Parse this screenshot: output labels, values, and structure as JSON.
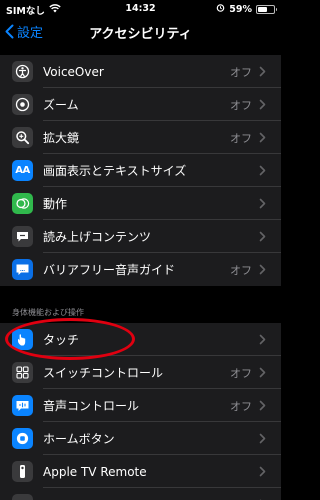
{
  "status": {
    "carrier": "SIMなし",
    "time": "14:32",
    "battery": "59%",
    "battery_level": 0.59
  },
  "nav": {
    "back_label": "設定",
    "title": "アクセシビリティ"
  },
  "vision": [
    {
      "key": "voiceover",
      "label": "VoiceOver",
      "value": "オフ",
      "icon_color": "#3a3a3c",
      "icon": "voiceover-icon"
    },
    {
      "key": "zoom",
      "label": "ズーム",
      "value": "オフ",
      "icon_color": "#3a3a3c",
      "icon": "zoom-icon"
    },
    {
      "key": "magnifier",
      "label": "拡大鏡",
      "value": "オフ",
      "icon_color": "#3a3a3c",
      "icon": "magnifier-icon"
    },
    {
      "key": "display-text",
      "label": "画面表示とテキストサイズ",
      "value": "",
      "icon_color": "#0a84ff",
      "icon": "text-size-icon"
    },
    {
      "key": "motion",
      "label": "動作",
      "value": "",
      "icon_color": "#30b84c",
      "icon": "motion-icon"
    },
    {
      "key": "spoken-content",
      "label": "読み上げコンテンツ",
      "value": "",
      "icon_color": "#3a3a3c",
      "icon": "speech-icon"
    },
    {
      "key": "audio-descriptions",
      "label": "バリアフリー音声ガイド",
      "value": "オフ",
      "icon_color": "#0a6fe6",
      "icon": "audio-description-icon"
    }
  ],
  "physical_header": "身体機能および操作",
  "physical": [
    {
      "key": "touch",
      "label": "タッチ",
      "value": "",
      "icon_color": "#0a84ff",
      "icon": "touch-hand-icon"
    },
    {
      "key": "switch-control",
      "label": "スイッチコントロール",
      "value": "オフ",
      "icon_color": "#3a3a3c",
      "icon": "switch-control-icon"
    },
    {
      "key": "voice-control",
      "label": "音声コントロール",
      "value": "オフ",
      "icon_color": "#0a84ff",
      "icon": "voice-control-icon"
    },
    {
      "key": "home-button",
      "label": "ホームボタン",
      "value": "",
      "icon_color": "#0a84ff",
      "icon": "home-button-icon"
    },
    {
      "key": "apple-tv-remote",
      "label": "Apple TV Remote",
      "value": "",
      "icon_color": "#3a3a3c",
      "icon": "tv-remote-icon"
    },
    {
      "key": "keyboards",
      "label": "",
      "value": "",
      "icon_color": "#3a3a3c",
      "icon": "keyboard-icon"
    }
  ],
  "annotation_color": "#e00010"
}
